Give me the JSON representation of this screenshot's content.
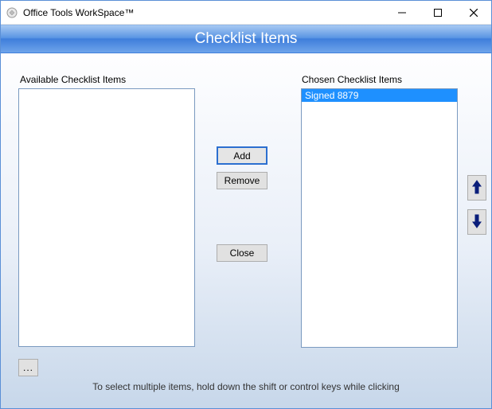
{
  "titlebar": {
    "title": "Office Tools WorkSpace™"
  },
  "banner": {
    "title": "Checklist Items"
  },
  "labels": {
    "available": "Available Checklist Items",
    "chosen": "Chosen Checklist Items"
  },
  "available_items": [],
  "chosen_items": [
    {
      "label": "Signed 8879",
      "selected": true
    }
  ],
  "buttons": {
    "add": "Add",
    "remove": "Remove",
    "close": "Close",
    "ellipsis": "..."
  },
  "hint": "To select multiple items, hold down the shift or control keys while clicking"
}
